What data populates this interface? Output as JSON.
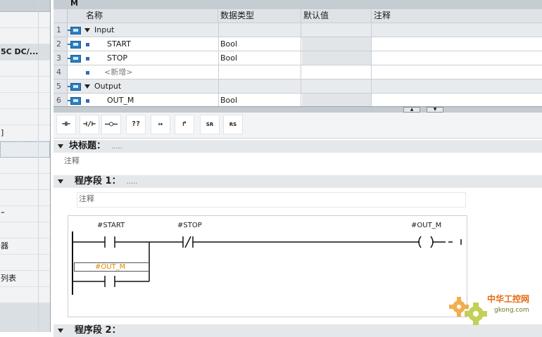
{
  "left_panel": {
    "rows": [
      {
        "label": ""
      },
      {
        "label": ""
      },
      {
        "label": "5C DC/...",
        "bold": true,
        "darkband": true
      },
      {
        "label": ""
      },
      {
        "label": ""
      },
      {
        "label": ""
      },
      {
        "label": ""
      },
      {
        "label": "]"
      },
      {
        "label": "",
        "selected": true
      },
      {
        "label": ""
      },
      {
        "label": ""
      },
      {
        "label": ""
      },
      {
        "label": "⁼"
      },
      {
        "label": ""
      },
      {
        "label": "器"
      },
      {
        "label": ""
      },
      {
        "label": "列表"
      },
      {
        "label": ""
      },
      {
        "label": "",
        "darkband": true
      },
      {
        "label": "",
        "darkband": true
      }
    ]
  },
  "title_strip": {
    "text": "M"
  },
  "interface": {
    "headers": {
      "name": "名称",
      "type": "数据类型",
      "default": "默认值",
      "comment": "注释"
    },
    "rows": [
      {
        "num": "1",
        "kind": "section",
        "name": "Input",
        "type": ""
      },
      {
        "num": "2",
        "kind": "var",
        "name": "START",
        "type": "Bool"
      },
      {
        "num": "3",
        "kind": "var",
        "name": "STOP",
        "type": "Bool"
      },
      {
        "num": "4",
        "kind": "new",
        "name": "<新增>",
        "type": ""
      },
      {
        "num": "5",
        "kind": "section",
        "name": "Output",
        "type": ""
      },
      {
        "num": "6",
        "kind": "var",
        "name": "OUT_M",
        "type": "Bool"
      }
    ]
  },
  "toolbar": {
    "buttons": [
      {
        "id": "no-contact",
        "label": "⊣⊢"
      },
      {
        "id": "nc-contact",
        "label": "⊣/⊢"
      },
      {
        "id": "coil",
        "label": "–○–"
      },
      {
        "id": "empty-box",
        "label": "??"
      },
      {
        "id": "open-branch",
        "label": "↦"
      },
      {
        "id": "close-branch",
        "label": "↱"
      },
      {
        "id": "sr",
        "label": "SR"
      },
      {
        "id": "rs",
        "label": "RS"
      }
    ]
  },
  "editor": {
    "block_title": "块标题：",
    "block_title_dots": ".....",
    "block_comment": "注释",
    "network1": {
      "title": "程序段 1：",
      "dots": ".....",
      "comment": "注释",
      "operands": {
        "start": "#START",
        "stop": "#STOP",
        "out": "#OUT_M",
        "branch": "#OUT_M"
      }
    },
    "network2": {
      "title": "程序段 2："
    }
  },
  "watermark": {
    "text": "中华工控网",
    "url": "gkong.com"
  },
  "colors": {
    "accent_blue": "#2c7fc1",
    "orange_operand": "#d98a00",
    "header_band": "#e4e8eb"
  }
}
